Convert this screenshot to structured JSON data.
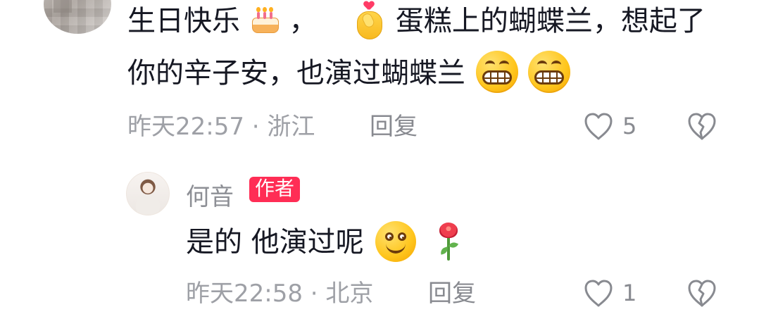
{
  "comment": {
    "line1_part1": "生日快乐",
    "line1_part2": "，",
    "line1_part3": "蛋糕上的蝴蝶兰，想起了",
    "line2_text": "你的辛子安，也演过蝴蝶兰",
    "emoji_cake": "cake-icon",
    "emoji_heart_hand": "finger-heart-icon",
    "emoji_grin": "grin-face-icon",
    "time": "昨天22:57",
    "location_separator": "·",
    "location": "浙江",
    "reply_label": "回复",
    "like_count": "5"
  },
  "reply": {
    "author_name": "何音",
    "author_badge": "作者",
    "text_part1": "是的 他演过呢",
    "emoji_smile": "smiling-face-icon",
    "emoji_rose": "rose-icon",
    "time": "昨天22:58",
    "location_separator": "·",
    "location": "北京",
    "reply_label": "回复",
    "like_count": "1"
  },
  "colors": {
    "text_primary": "#161823",
    "text_secondary": "#9ea0a6",
    "action_text": "#888a90",
    "author_badge_bg": "#ff2d55",
    "author_badge_text": "#ffffff",
    "page_bg": "#ffffff"
  }
}
